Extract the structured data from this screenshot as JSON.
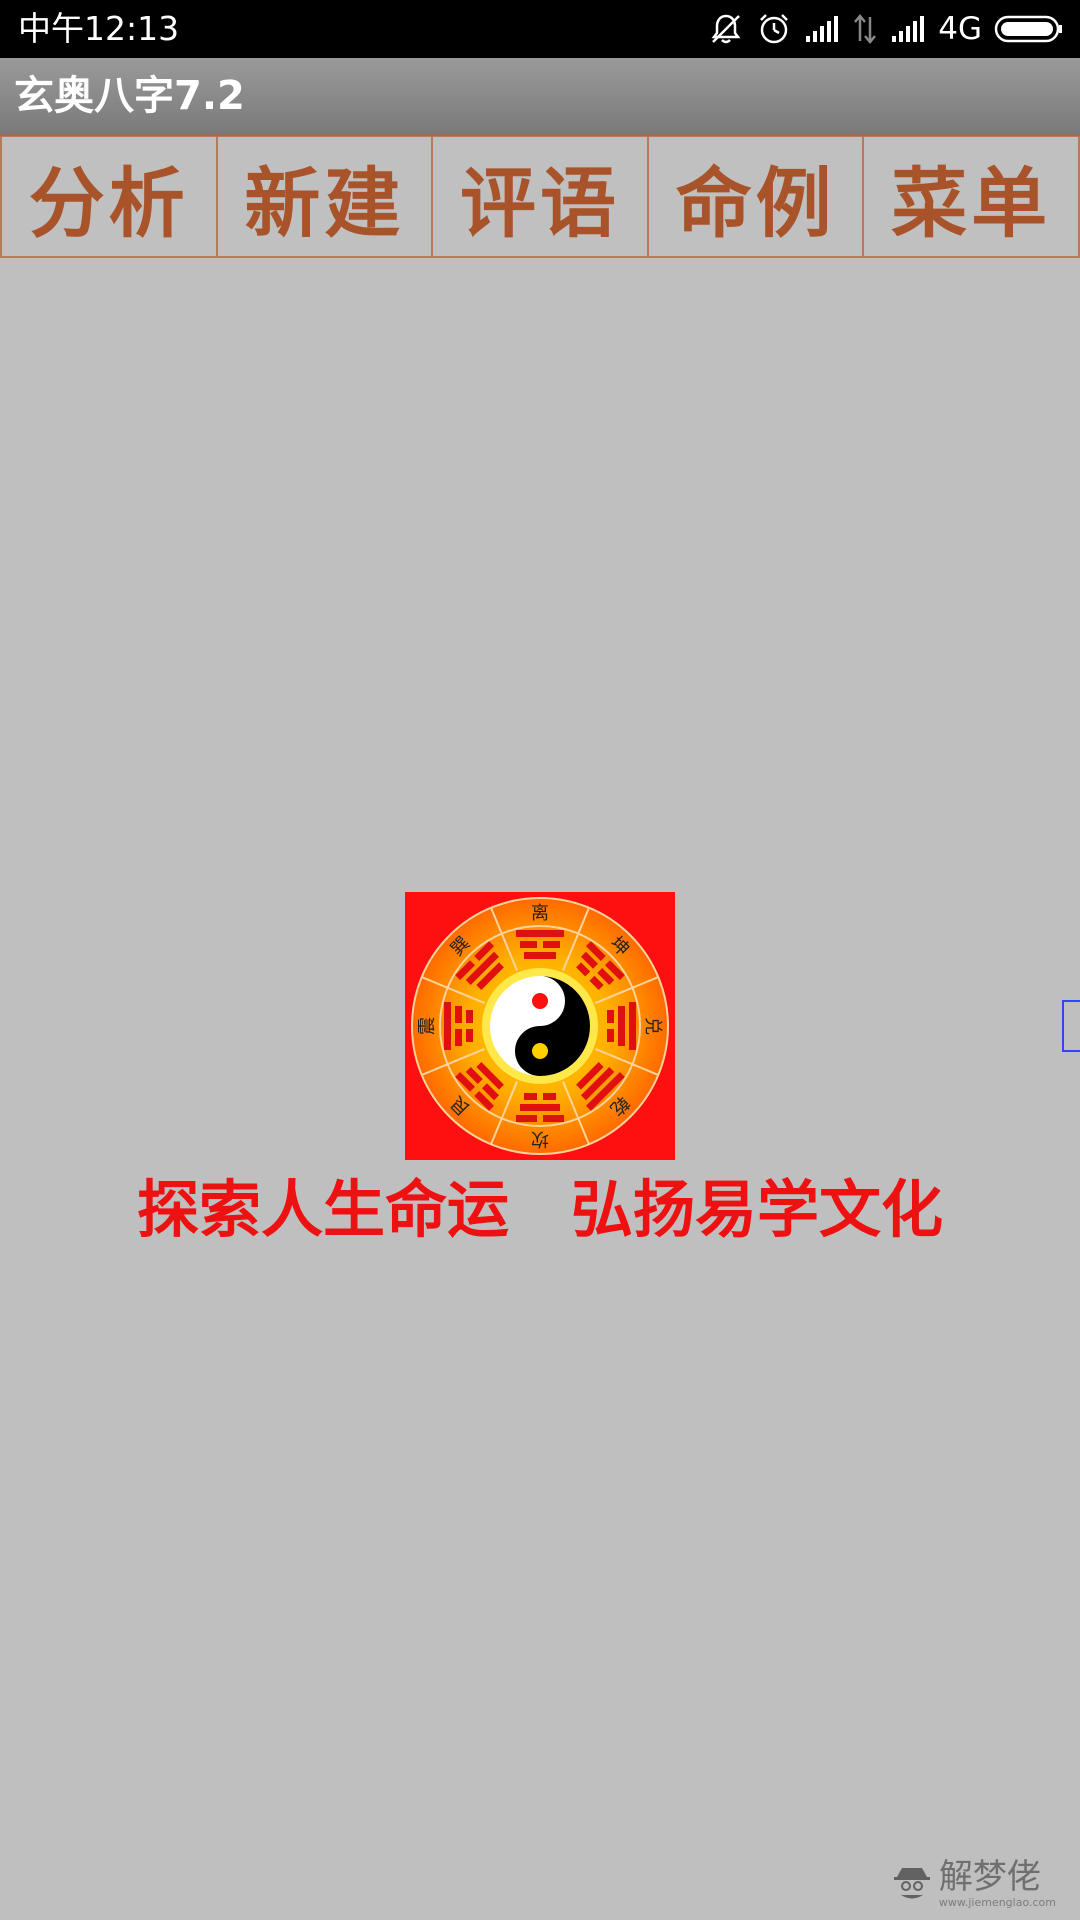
{
  "status_bar": {
    "time": "中午12:13",
    "network": "4G",
    "icons": [
      "mute-icon",
      "alarm-icon",
      "signal-icon",
      "data-arrows-icon",
      "signal-icon",
      "battery-icon"
    ]
  },
  "app": {
    "title": "玄奥八字7.2"
  },
  "menu": {
    "items": [
      {
        "label": "分析"
      },
      {
        "label": "新建"
      },
      {
        "label": "评语"
      },
      {
        "label": "命例"
      },
      {
        "label": "菜单"
      }
    ]
  },
  "logo": {
    "trigrams": [
      "离",
      "坤",
      "兑",
      "乾",
      "坎",
      "艮",
      "震",
      "巽"
    ]
  },
  "slogan": {
    "text": "探索人生命运　弘扬易学文化"
  },
  "watermark": {
    "name": "解梦佬",
    "url": "www.jiemenglao.com"
  },
  "colors": {
    "menu_text": "#a9532b",
    "slogan": "#ee1111",
    "background": "#bfbfbf"
  }
}
